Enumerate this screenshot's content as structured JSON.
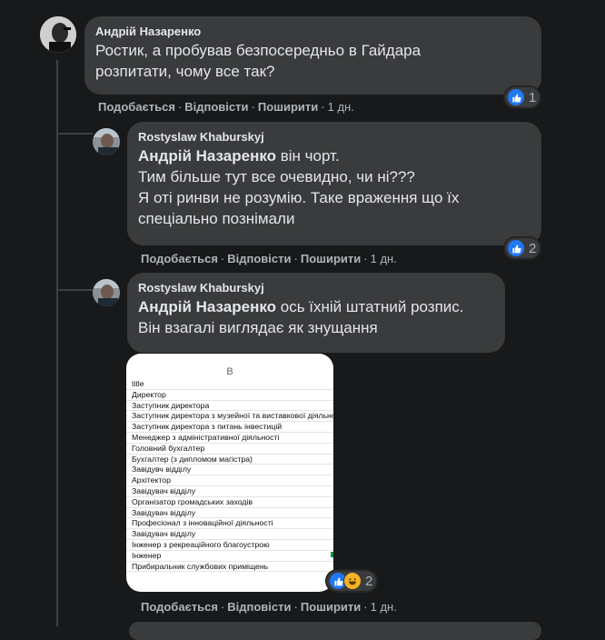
{
  "comments": [
    {
      "author": "Андрій Назаренко",
      "text": "Ростик, а пробував безпосередньо в Гайдара\nрозпитати, чому все так?",
      "mention": "",
      "reactions": {
        "count": "1",
        "types": [
          "like"
        ]
      },
      "time": "1 дн."
    },
    {
      "author": "Rostyslaw Khaburskyj",
      "mention": "Андрій Назаренко",
      "text_after_mention": " він чорт.",
      "text_rest": "Тим більше тут все очевидно, чи ні???\nЯ оті ринви не розумію. Таке враження що їх\nспеціально познімали",
      "reactions": {
        "count": "2",
        "types": [
          "like"
        ]
      },
      "time": "1 дн."
    },
    {
      "author": "Rostyslaw Khaburskyj",
      "mention": "Андрій Назаренко",
      "text_after_mention": " ось їхній штатний розпис.",
      "text_rest": "Він взагалі виглядає як знущання",
      "reactions": {
        "count": "2",
        "types": [
          "like",
          "haha"
        ]
      },
      "time": "1 дн."
    }
  ],
  "actions": {
    "like": "Подобається",
    "reply": "Відповісти",
    "share": "Поширити",
    "separator": "·"
  },
  "attachment": {
    "column_header": "B",
    "rows": [
      "title",
      "Директор",
      "Заступник директора",
      "Заступник директора з музейної та виставкової діяльно",
      "Заступник директора з питань інвестицій",
      "Менеджер з адміністративної діяльності",
      "Головний бухгалтер",
      "Бухгалтер (з дипломом магістра)",
      "Завідувч відділу",
      "Архітектор",
      "Завідувач відділу",
      "Організатор громадських заходів",
      "Завідувач відділу",
      "Професіонал з інноваційної діяльності",
      "Завідувач відділу",
      "Інженер з рекреаційного благоустрою",
      "Інженер",
      "Прибиральник службових приміщень"
    ]
  },
  "colors": {
    "background": "#18191a",
    "bubble": "#3a3b3c",
    "text": "#e4e6eb",
    "muted": "#b0b3b8",
    "like": "#2078f4",
    "haha": "#f7b125"
  },
  "icons": [
    "avatar-photo",
    "like-icon",
    "haha-icon"
  ]
}
